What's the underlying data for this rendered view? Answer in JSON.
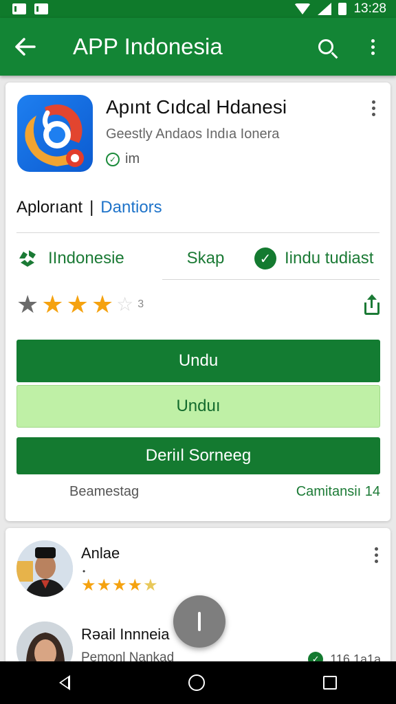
{
  "status_bar": {
    "time": "13:28"
  },
  "app_bar": {
    "title": "APP Indonesia"
  },
  "app": {
    "name": "Apınt Cıdcal Hdanesi",
    "developer": "Geestly Andaos Indıa Ionera",
    "meta": "im"
  },
  "tags": {
    "primary": "Aplorıant",
    "separator": "|",
    "link": "Dantiors"
  },
  "info": {
    "a": "IIndonesie",
    "b": "Skap",
    "c": "Iindu tudiast"
  },
  "rating": {
    "count": "3",
    "filled": 3,
    "total": 5
  },
  "buttons": {
    "primary": "Undu",
    "light": "Unduı",
    "secondary": "Deriıl Sorneeg"
  },
  "footer": {
    "left": "Beamestag",
    "right": "Camitansiı 14"
  },
  "reviews": [
    {
      "name": "Anlae",
      "sub": "•",
      "stars": 4.5
    },
    {
      "name": "Rəail Innneia",
      "sub": "Pemonl Nankad",
      "badge": "116 1a1a"
    }
  ],
  "colors": {
    "brand": "#138535",
    "accent": "#f5a20f",
    "link": "#1e73c9"
  }
}
